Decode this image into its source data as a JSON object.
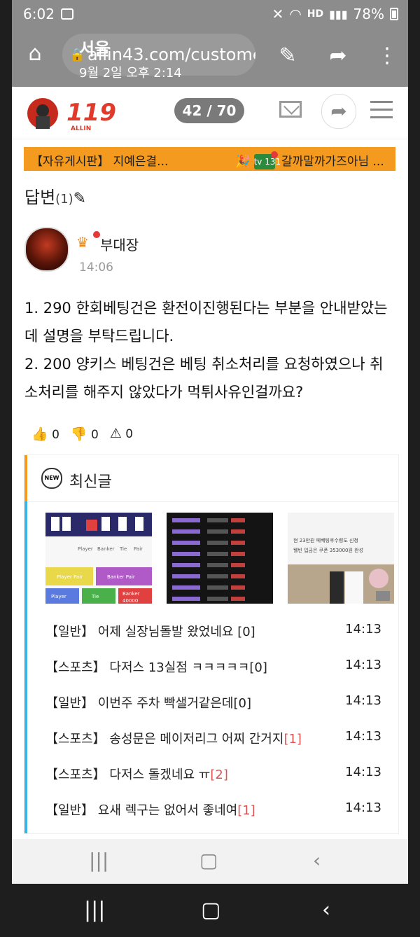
{
  "status": {
    "time": "6:02",
    "network": "HD",
    "battery": "78%"
  },
  "browser": {
    "url": "allin43.com/custome",
    "popup_title": "서울",
    "popup_date": "9월 2일 오후 2:14"
  },
  "site": {
    "logo_text": "119",
    "logo_sub": "ALLIN",
    "page_counter": "42 / 70"
  },
  "ticker": {
    "item1": "【자유게시판】 지예은결...",
    "item2": "갈까말까가즈아님 ...",
    "tv_label": "tv 131"
  },
  "answer": {
    "heading": "답변",
    "count": "(1)",
    "author": "부대장",
    "time": "14:06",
    "body": "1. 290 한회베팅건은 환전이진행된다는 부분을 안내받았는데 설명을 부탁드립니다.\n2. 200 양키스 베팅건은 베팅 취소처리를 요청하였으나 취소처리를 해주지 않았다가 먹튀사유인걸까요?",
    "likes": "0",
    "dislikes": "0",
    "reports": "0"
  },
  "latest": {
    "title": "최신글",
    "new_badge": "NEW",
    "items": [
      {
        "category": "【일반】",
        "title": "어제 실장님돌발 왔었네요",
        "comments": "[0]",
        "time": "14:13"
      },
      {
        "category": "【스포츠】",
        "title": "다저스 13실점 ㅋㅋㅋㅋㅋ",
        "comments": "[0]",
        "time": "14:13"
      },
      {
        "category": "【일반】",
        "title": "이번주 주차 빡샐거같은데",
        "comments": "[0]",
        "time": "14:13"
      },
      {
        "category": "【스포츠】",
        "title": "송성문은 메이저리그 어찌 간거지",
        "comments": "[1]",
        "time": "14:13"
      },
      {
        "category": "【스포츠】",
        "title": "다저스 돌겠네요 ㅠ",
        "comments": "[2]",
        "time": "14:13"
      },
      {
        "category": "【일반】",
        "title": "요새 렉구는 없어서 좋네여",
        "comments": "[1]",
        "time": "14:13"
      }
    ],
    "thumb1": {
      "player": "Player",
      "banker": "Banker",
      "tie": "Tie",
      "pair": "Pair",
      "player_pair": "Player Pair",
      "banker_pair": "Banker Pair",
      "bottom_banker": "Banker",
      "bottom_value": "40000"
    },
    "thumb3": {
      "line1": "현 23만원 페베팅후수령도 신청",
      "line2": "웰빈 입금은 쿠폰 353000원 완성"
    }
  },
  "colors": {
    "accent": "#f39a1f",
    "link_bar": "#3ab4e6",
    "comment_red": "#e25454"
  }
}
